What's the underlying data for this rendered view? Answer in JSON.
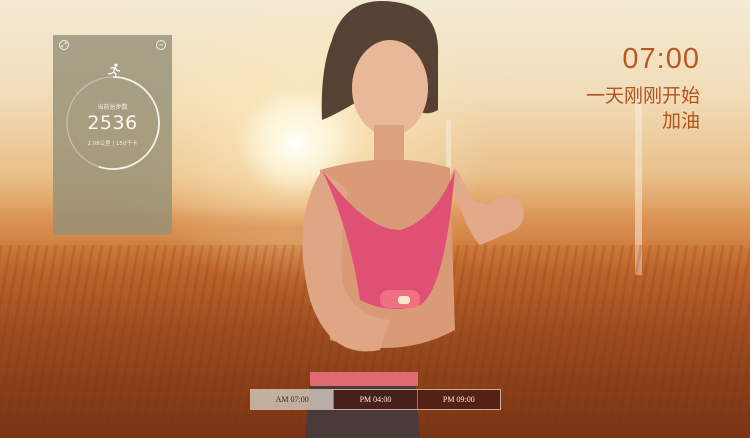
{
  "widget": {
    "steps_label": "当前总步数",
    "steps_value": "2536",
    "sub_info": "2.08公里 | 150千卡",
    "progress": 0.55,
    "left_button_icon": "expand-icon",
    "right_button_icon": "minus-icon"
  },
  "headline": {
    "time": "07:00",
    "line1": "一天刚刚开始",
    "line2": "加油"
  },
  "tabs": [
    {
      "label": "AM 07:00",
      "active": true
    },
    {
      "label": "PM 04:00",
      "active": false
    },
    {
      "label": "PM 09:00",
      "active": false
    }
  ],
  "colors": {
    "accent": "#b85a22",
    "widget_bg": "#96917a",
    "tab_dark": "#461914",
    "tab_active": "#cdc3b9"
  }
}
